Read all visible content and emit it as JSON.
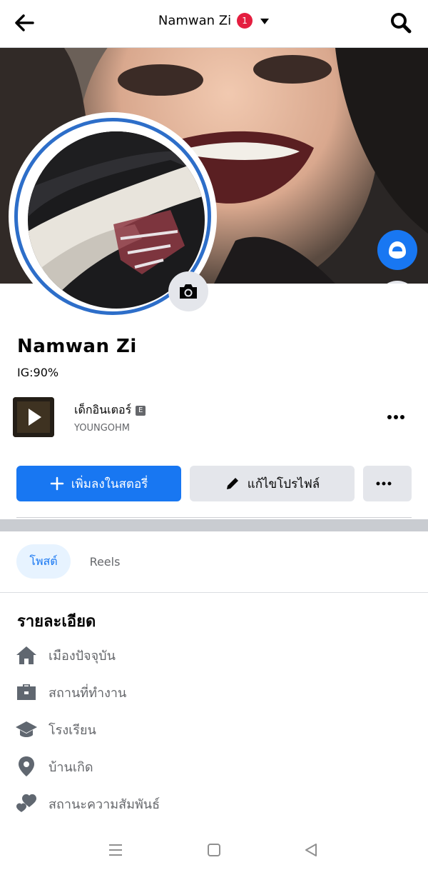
{
  "header": {
    "title": "Namwan Zi",
    "notification_count": "1"
  },
  "profile": {
    "name": "Namwan Zi",
    "bio": "IG:90%"
  },
  "music": {
    "song": "เด็กอินเตอร์",
    "explicit_badge": "E",
    "artist": "YOUNGOHM"
  },
  "actions": {
    "add_story": "เพิ่มลงในสตอรี่",
    "edit_profile": "แก้ไขโปรไฟล์"
  },
  "tabs": {
    "posts": "โพสต์",
    "reels": "Reels"
  },
  "details": {
    "title": "รายละเอียด",
    "items": [
      {
        "label": "เมืองปัจจุบัน",
        "icon": "home-icon"
      },
      {
        "label": "สถานที่ทำงาน",
        "icon": "briefcase-icon"
      },
      {
        "label": "โรงเรียน",
        "icon": "graduation-cap-icon"
      },
      {
        "label": "บ้านเกิด",
        "icon": "location-pin-icon"
      },
      {
        "label": "สถานะความสัมพันธ์",
        "icon": "hearts-icon"
      }
    ]
  },
  "colors": {
    "accent": "#1877f2",
    "badge": "#e41e3f",
    "avatar_ring": "#2d6ec9"
  }
}
